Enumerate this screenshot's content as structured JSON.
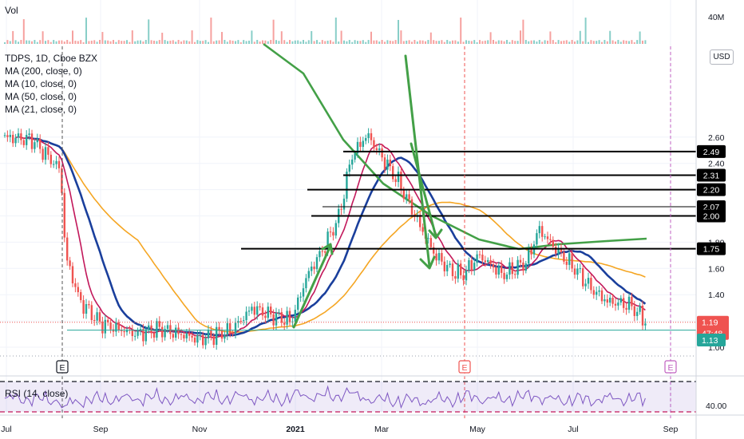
{
  "legend": {
    "volume_label": "Vol",
    "symbol": "TDPS, 1D, Cboe BZX",
    "ma200": "MA (200, close, 0)",
    "ma10": "MA (10, close, 0)",
    "ma50": "MA (50, close, 0)",
    "ma21": "MA (21, close, 0)",
    "rsi": "RSI (14, close)"
  },
  "currency_button": "USD",
  "price_label": "1.19",
  "countdown_label": "47:48",
  "support_label": "1.13",
  "chart_data": {
    "type": "candlestick",
    "title": "TDPS, 1D, Cboe BZX",
    "x_ticks": [
      "Jul",
      "Sep",
      "Nov",
      "2021",
      "Mar",
      "May",
      "Jul",
      "Sep"
    ],
    "y_ticks": [
      "1.00",
      "1.20",
      "1.40",
      "1.60",
      "1.80",
      "2.00",
      "2.20",
      "2.40",
      "2.60"
    ],
    "ylim": [
      0.94,
      2.67
    ],
    "volume_axis_tick": "40M",
    "rsi_axis_tick": "40.00",
    "horizontal_levels": [
      {
        "value": 2.49,
        "label": "2.49"
      },
      {
        "value": 2.31,
        "label": "2.31"
      },
      {
        "value": 2.2,
        "label": "2.20"
      },
      {
        "value": 2.07,
        "label": "2.07"
      },
      {
        "value": 2.0,
        "label": "2.00"
      },
      {
        "value": 1.75,
        "label": "1.75"
      }
    ],
    "last_price": 1.19,
    "support_level": 1.13,
    "event_markers": [
      "E",
      "E",
      "E"
    ],
    "colors": {
      "ma200": "#43a047",
      "ma10": "#c2185b",
      "ma50": "#f5a623",
      "ma21": "#1a3f9c",
      "up": "#26a69a",
      "down": "#ef5350",
      "rsi": "#7e57c2"
    },
    "grid": true
  }
}
